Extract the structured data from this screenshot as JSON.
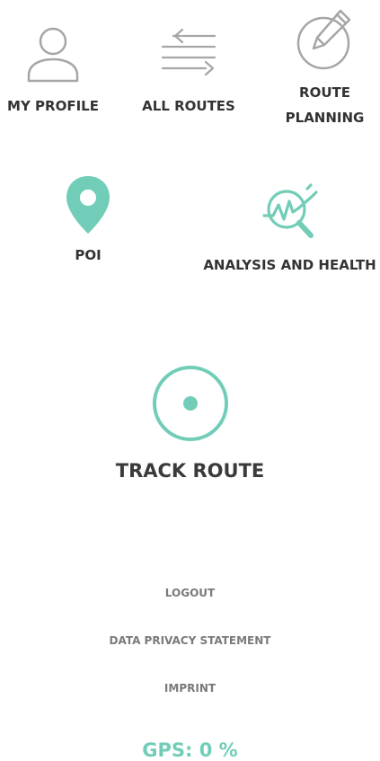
{
  "menu": {
    "my_profile": {
      "label": "MY PROFILE",
      "icon": "user-icon"
    },
    "all_routes": {
      "label": "ALL ROUTES",
      "icon": "arrows-exchange-icon"
    },
    "route_planning": {
      "label_line1": "ROUTE",
      "label_line2": "PLANNING",
      "icon": "pencil-circle-icon"
    },
    "poi": {
      "label": "POI",
      "icon": "map-pin-icon"
    },
    "analysis": {
      "label": "ANALYSIS AND HEALTH",
      "icon": "analysis-magnifier-icon"
    },
    "track_route": {
      "label": "TRACK ROUTE",
      "icon": "record-circle-icon"
    }
  },
  "footer": {
    "logout": "LOGOUT",
    "privacy": "DATA PRIVACY STATEMENT",
    "imprint": "IMPRINT"
  },
  "status": {
    "gps": "GPS: 0 %"
  },
  "colors": {
    "accent": "#72cdb8",
    "icon_gray": "#a6a6a6",
    "text_dark": "#333333",
    "text_gray": "#7a7a7a"
  }
}
